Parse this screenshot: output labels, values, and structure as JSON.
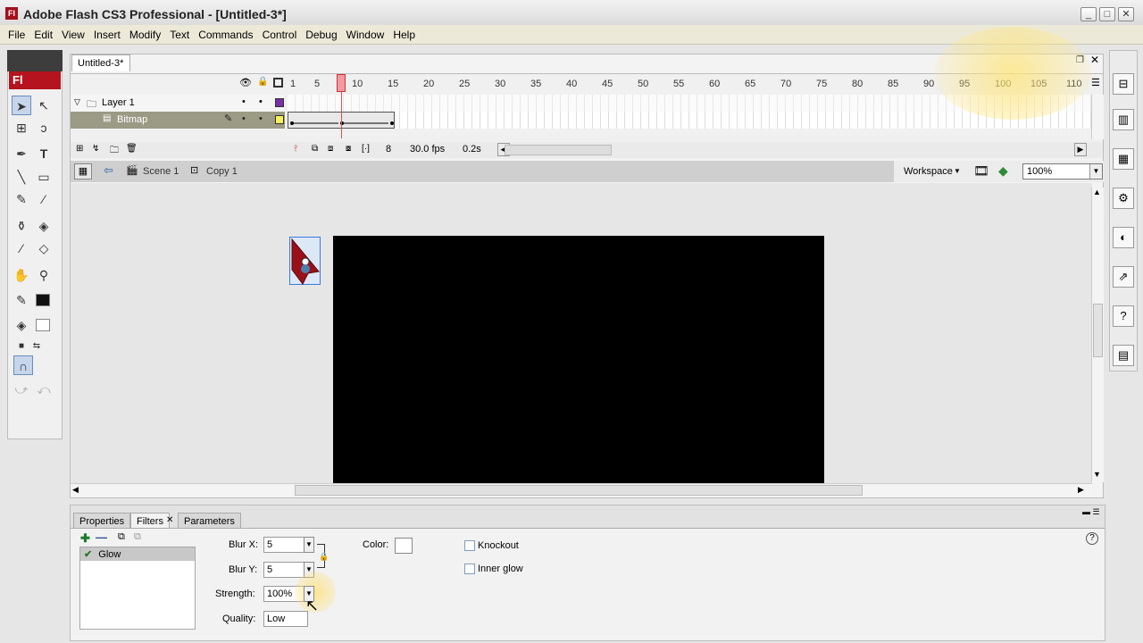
{
  "window": {
    "title": "Adobe Flash CS3 Professional - [Untitled-3*]",
    "app_icon": "Fl",
    "controls": [
      "_",
      "□",
      "✕"
    ]
  },
  "menu": [
    "File",
    "Edit",
    "View",
    "Insert",
    "Modify",
    "Text",
    "Commands",
    "Control",
    "Debug",
    "Window",
    "Help"
  ],
  "tools": {
    "logo": "Fl",
    "icons": [
      "selection-tool-icon",
      "subselection-tool-icon",
      "free-transform-tool-icon",
      "lasso-tool-icon",
      "pen-tool-icon",
      "text-tool-icon",
      "line-tool-icon",
      "rectangle-tool-icon",
      "pencil-tool-icon",
      "brush-tool-icon",
      "ink-bottle-tool-icon",
      "paint-bucket-tool-icon",
      "eyedropper-tool-icon",
      "eraser-tool-icon",
      "hand-tool-icon",
      "zoom-tool-icon"
    ]
  },
  "document": {
    "tab": "Untitled-3*",
    "frame_numbers": [
      "1",
      "5",
      "10",
      "15",
      "20",
      "25",
      "30",
      "35",
      "40",
      "45",
      "50",
      "55",
      "60",
      "65",
      "70",
      "75",
      "80",
      "85",
      "90",
      "95",
      "100",
      "105",
      "110"
    ],
    "layers": [
      {
        "name": "Layer 1"
      },
      {
        "name": "Bitmap"
      }
    ],
    "footer": {
      "current_frame": "8",
      "fps": "30.0 fps",
      "time": "0.2s"
    }
  },
  "editbar": {
    "scene": "Scene 1",
    "symbol": "Copy 1",
    "workspace": "Workspace",
    "zoom": "100%"
  },
  "properties": {
    "tabs": [
      "Properties",
      "Filters",
      "Parameters"
    ],
    "active_tab": "Filters",
    "filters": [
      "Glow"
    ],
    "blur_x_label": "Blur X:",
    "blur_x": "5",
    "blur_y_label": "Blur Y:",
    "blur_y": "5",
    "strength_label": "Strength:",
    "strength": "100%",
    "quality_label": "Quality:",
    "quality": "Low",
    "color_label": "Color:",
    "knockout_label": "Knockout",
    "inner_glow_label": "Inner glow"
  }
}
